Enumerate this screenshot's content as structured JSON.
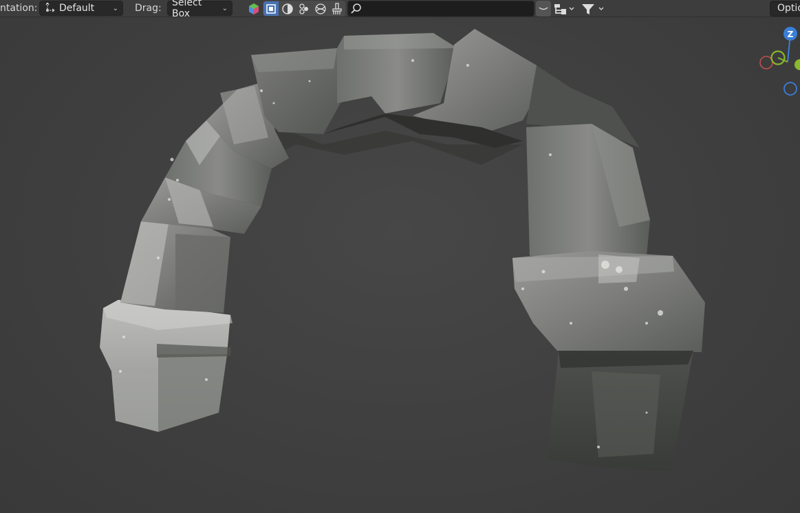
{
  "header": {
    "orientation_label": "ntation:",
    "orientation_value": "Default",
    "drag_label": "Drag:",
    "drag_value": "Select Box",
    "options_label": "Optio"
  },
  "gizmo": {
    "z_label": "Z"
  },
  "icons": [
    "transform-orientation-icon",
    "chevron-down-icon",
    "show-gizmo-color-icon",
    "select-box-icon",
    "select-circle-icon",
    "tweak-icon",
    "select-lasso-icon",
    "annotate-icon",
    "search-icon",
    "filter-icon",
    "outliner-hierarchy-icon"
  ],
  "colors": {
    "header_bg": "#3d3d3d",
    "viewport_bg": "#404040",
    "active_tool": "#4772b3",
    "axis_x": "#d9534f",
    "axis_y": "#8ab92c",
    "axis_z": "#3a7fd8"
  }
}
